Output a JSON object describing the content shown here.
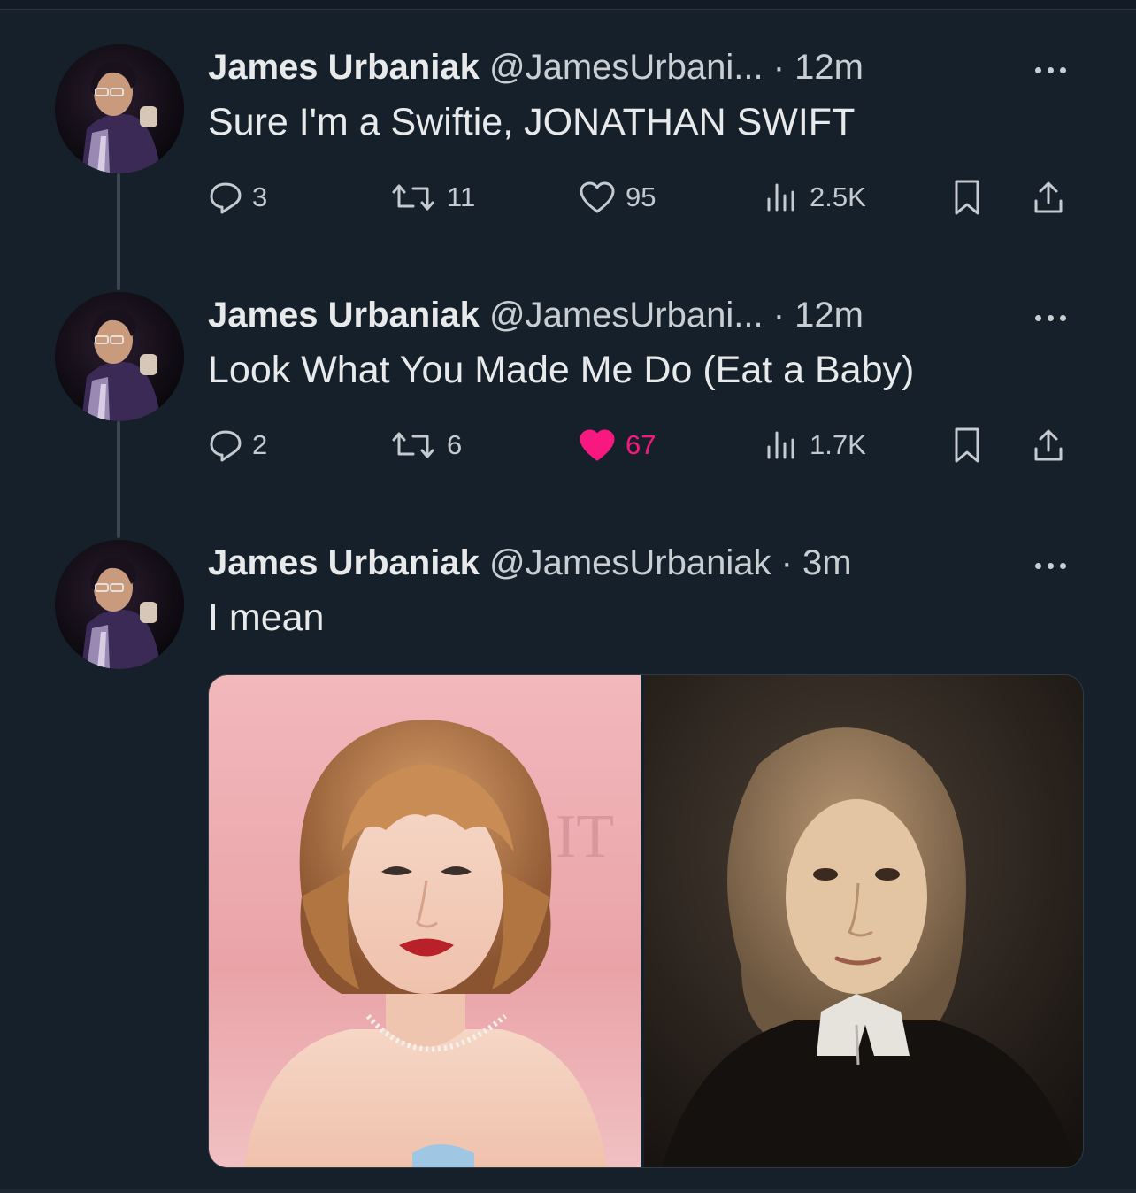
{
  "colors": {
    "background": "#15202b",
    "text_primary": "#e7e9ea",
    "text_secondary": "#c9ced3",
    "like_active": "#f91880"
  },
  "tweets": [
    {
      "name": "James Urbaniak",
      "handle": "@JamesUrbani...",
      "separator": "·",
      "time": "12m",
      "text": "Sure I'm a Swiftie, JONATHAN SWIFT",
      "replies": "3",
      "retweets": "11",
      "likes": "95",
      "liked": false,
      "views": "2.5K"
    },
    {
      "name": "James Urbaniak",
      "handle": "@JamesUrbani...",
      "separator": "·",
      "time": "12m",
      "text": "Look What You Made Me Do (Eat a Baby)",
      "replies": "2",
      "retweets": "6",
      "likes": "67",
      "liked": true,
      "views": "1.7K"
    },
    {
      "name": "James Urbaniak",
      "handle": "@JamesUrbaniak",
      "separator": "·",
      "time": "3m",
      "text": "I mean",
      "media": [
        "photo-woman-red-carpet",
        "photo-portrait-painting"
      ]
    }
  ],
  "icons": {
    "reply": "reply-icon",
    "retweet": "retweet-icon",
    "like": "heart-icon",
    "views": "views-icon",
    "bookmark": "bookmark-icon",
    "share": "share-icon",
    "more": "more-icon"
  }
}
